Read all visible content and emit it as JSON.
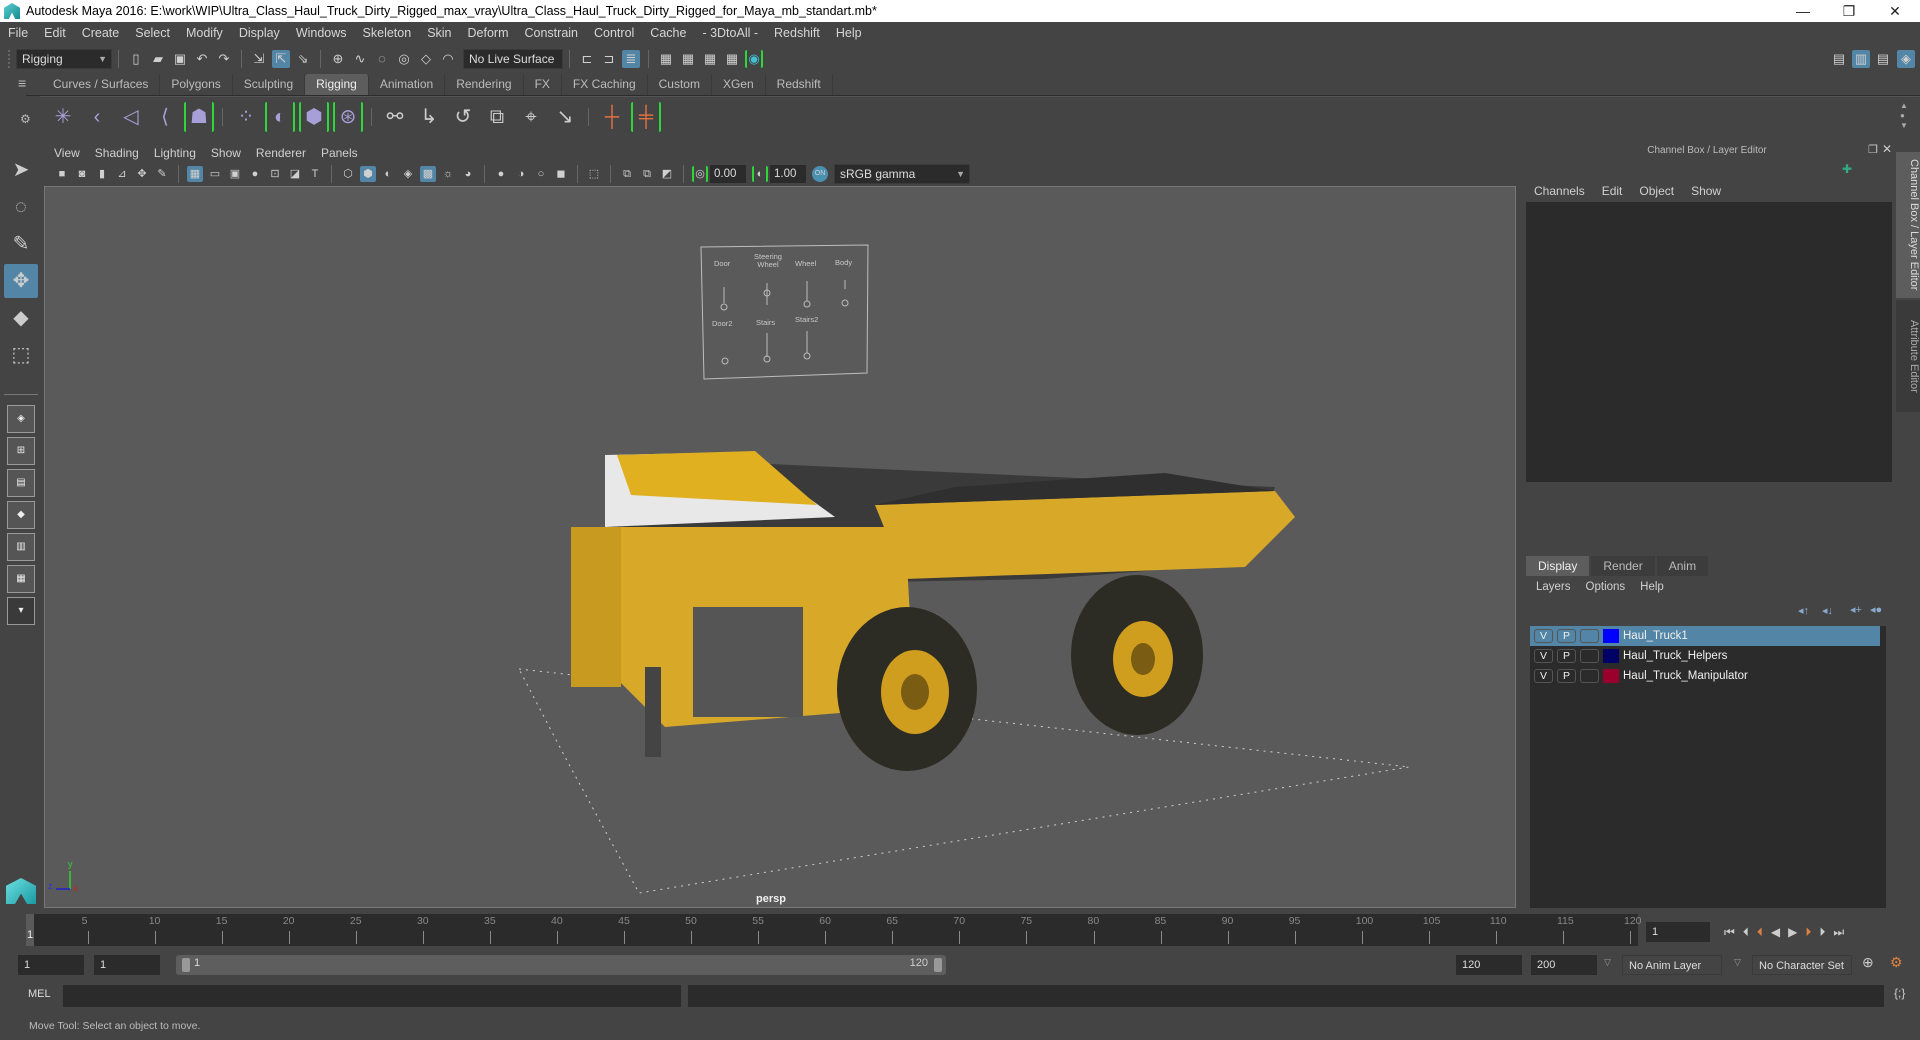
{
  "app": {
    "title": "Autodesk Maya 2016: E:\\work\\WIP\\Ultra_Class_Haul_Truck_Dirty_Rigged_max_vray\\Ultra_Class_Haul_Truck_Dirty_Rigged_for_Maya_mb_standart.mb*",
    "window_controls": {
      "minimize": "—",
      "restore": "❐",
      "close": "✕"
    }
  },
  "menubar": [
    "File",
    "Edit",
    "Create",
    "Select",
    "Modify",
    "Display",
    "Windows",
    "Skeleton",
    "Skin",
    "Deform",
    "Constrain",
    "Control",
    "Cache",
    "- 3DtoAll -",
    "Redshift",
    "Help"
  ],
  "statusline": {
    "menuset": "Rigging",
    "live_surface": "No Live Surface"
  },
  "shelf": {
    "tabs": [
      "Curves / Surfaces",
      "Polygons",
      "Sculpting",
      "Rigging",
      "Animation",
      "Rendering",
      "FX",
      "FX Caching",
      "Custom",
      "XGen",
      "Redshift"
    ],
    "active_tab": "Rigging",
    "icons": [
      "create-joints-icon",
      "insert-joint-icon",
      "ik-handle-icon",
      "ik-spline-icon",
      "quick-rig-icon",
      "bind-skin-icon",
      "smooth-bind-icon",
      "lattice-icon",
      "cluster-icon",
      "parent-constraint-icon",
      "point-constraint-icon",
      "orient-constraint-icon",
      "scale-constraint-icon",
      "aim-constraint-icon",
      "pole-vector-icon",
      "locator-icon",
      "locator-constraint-icon"
    ]
  },
  "tools": [
    "select-tool",
    "lasso-tool",
    "paint-select-tool",
    "move-tool",
    "rotate-tool",
    "scale-tool"
  ],
  "active_tool": "move-tool",
  "viewport": {
    "menu": [
      "View",
      "Shading",
      "Lighting",
      "Show",
      "Renderer",
      "Panels"
    ],
    "exposure": "0.00",
    "gamma": "1.00",
    "color_space": "sRGB gamma",
    "camera_label": "persp",
    "control_panel": {
      "labels_top": [
        "Door",
        "Steering Wheel",
        "Wheel",
        "Body"
      ],
      "labels_bottom": [
        "Door2",
        "Stairs",
        "Stairs2"
      ]
    },
    "axis": {
      "x": "x",
      "y": "y",
      "z": "z"
    }
  },
  "channel_box": {
    "title": "Channel Box / Layer Editor",
    "menu": [
      "Channels",
      "Edit",
      "Object",
      "Show"
    ]
  },
  "layer_editor": {
    "tabs": [
      "Display",
      "Render",
      "Anim"
    ],
    "active_tab": "Display",
    "menu": [
      "Layers",
      "Options",
      "Help"
    ],
    "layers": [
      {
        "v": "V",
        "p": "P",
        "color": "#0000ff",
        "name": "Haul_Truck1",
        "selected": true
      },
      {
        "v": "V",
        "p": "P",
        "color": "#000066",
        "name": "Haul_Truck_Helpers",
        "selected": false
      },
      {
        "v": "V",
        "p": "P",
        "color": "#99002b",
        "name": "Haul_Truck_Manipulator",
        "selected": false
      }
    ]
  },
  "side_tabs": [
    "Channel Box / Layer Editor",
    "Attribute Editor"
  ],
  "timeline": {
    "ticks": [
      5,
      10,
      15,
      20,
      25,
      30,
      35,
      40,
      45,
      50,
      55,
      60,
      65,
      70,
      75,
      80,
      85,
      90,
      95,
      100,
      105,
      110,
      115,
      120
    ],
    "start": 1,
    "end": 120,
    "current_frame": "1"
  },
  "range": {
    "anim_start": "1",
    "playback_start": "1",
    "slider_start": "1",
    "slider_end": "120",
    "playback_end": "120",
    "anim_end": "200",
    "anim_layer": "No Anim Layer",
    "character_set": "No Character Set"
  },
  "command_line": {
    "language": "MEL"
  },
  "help_line": "Move Tool: Select an object to move."
}
